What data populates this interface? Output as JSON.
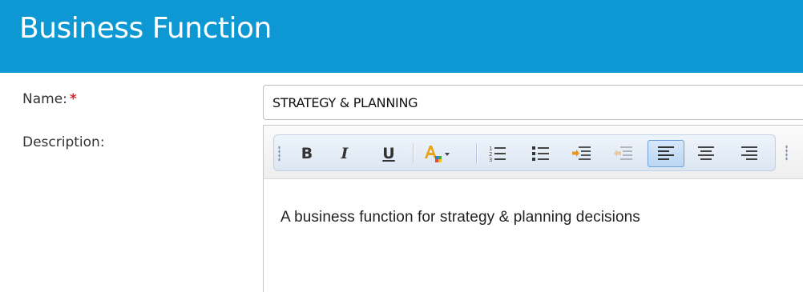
{
  "header": {
    "title": "Business Function"
  },
  "form": {
    "name_label": "Name:",
    "required_marker": "*",
    "name_value": "STRATEGY & PLANNING",
    "description_label": "Description:",
    "description_text": "A business function for strategy & planning decisions"
  },
  "toolbar": {
    "buttons": [
      {
        "name": "bold",
        "label": "B"
      },
      {
        "name": "italic",
        "label": "I"
      },
      {
        "name": "underline",
        "label": "U"
      },
      {
        "name": "font-color",
        "icon": "font-color-icon"
      },
      {
        "name": "numbered-list",
        "icon": "numbered-list-icon"
      },
      {
        "name": "bulleted-list",
        "icon": "bulleted-list-icon"
      },
      {
        "name": "increase-indent",
        "icon": "indent-icon"
      },
      {
        "name": "decrease-indent",
        "icon": "outdent-icon",
        "disabled": true
      },
      {
        "name": "align-left",
        "icon": "align-left-icon",
        "active": true
      },
      {
        "name": "align-center",
        "icon": "align-center-icon"
      },
      {
        "name": "align-right",
        "icon": "align-right-icon"
      }
    ]
  },
  "colors": {
    "header_bg": "#0d98d3",
    "required": "#d9252b",
    "toolbar_bg": "#dce6f2",
    "active_button": "#bcd6f4"
  }
}
